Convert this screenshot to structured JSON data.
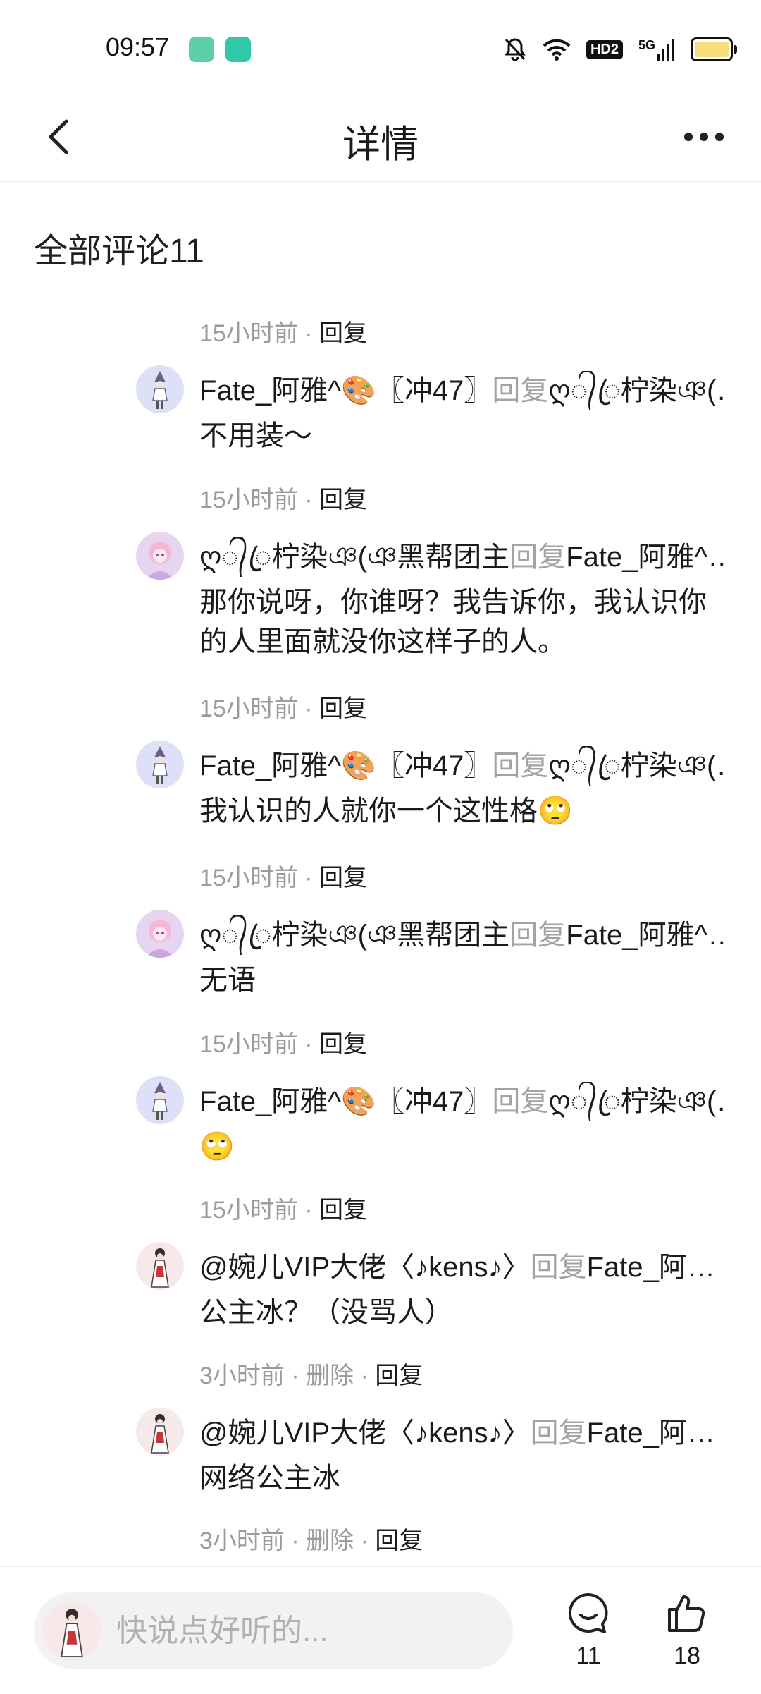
{
  "status_bar": {
    "time": "09:57",
    "hd_label": "HD2",
    "network_label": "5G",
    "battery_color": "#f8dc7a"
  },
  "header": {
    "title": "详情"
  },
  "comments_header": {
    "title": "全部评论11"
  },
  "comments": [
    {
      "time": "15小时前 · ",
      "reply_label": "回复",
      "author": "Fate_阿雅^🎨〖冲47〗",
      "reply_word": "回复",
      "target": "ღ᭄ꦿ柠染ঞ(…",
      "text": "不用装～",
      "avatar": "avatar-witch"
    },
    {
      "time": "15小时前 · ",
      "reply_label": "回复",
      "author": "ღ᭄ꦿ柠染ঞ(ঞ黑帮团主",
      "reply_word": "回复",
      "target": "Fate_阿雅^…",
      "text": "那你说呀，你谁呀？我告诉你，我认识你的人里面就没你这样子的人。",
      "avatar": "avatar-pink"
    },
    {
      "time": "15小时前 · ",
      "reply_label": "回复",
      "author": "Fate_阿雅^🎨〖冲47〗",
      "reply_word": "回复",
      "target": "ღ᭄ꦿ柠染ঞ(…",
      "text": "我认识的人就你一个这性格🙄",
      "avatar": "avatar-witch"
    },
    {
      "time": "15小时前 · ",
      "reply_label": "回复",
      "author": "ღ᭄ꦿ柠染ঞ(ঞ黑帮团主",
      "reply_word": "回复",
      "target": "Fate_阿雅^…",
      "text": "无语",
      "avatar": "avatar-pink"
    },
    {
      "time": "15小时前 · ",
      "reply_label": "回复",
      "author": "Fate_阿雅^🎨〖冲47〗",
      "reply_word": "回复",
      "target": "ღ᭄ꦿ柠染ঞ(…",
      "text": "🙄",
      "avatar": "avatar-witch"
    },
    {
      "time": "15小时前 · ",
      "reply_label": "回复",
      "author": "@婉儿VIP大佬〈♪kens♪〉",
      "reply_word": "回复",
      "target": "Fate_阿…",
      "text": "公主冰？（没骂人）",
      "avatar": "avatar-kimono"
    },
    {
      "time": "3小时前 · 删除 · ",
      "reply_label": "回复",
      "author": "@婉儿VIP大佬〈♪kens♪〉",
      "reply_word": "回复",
      "target": "Fate_阿…",
      "text": "网络公主冰",
      "avatar": "avatar-kimono"
    }
  ],
  "last_meta": {
    "time": "3小时前 · 删除 · ",
    "reply_label": "回复"
  },
  "bottom_bar": {
    "input_placeholder": "快说点好听的...",
    "comment_count": "11",
    "like_count": "18"
  }
}
